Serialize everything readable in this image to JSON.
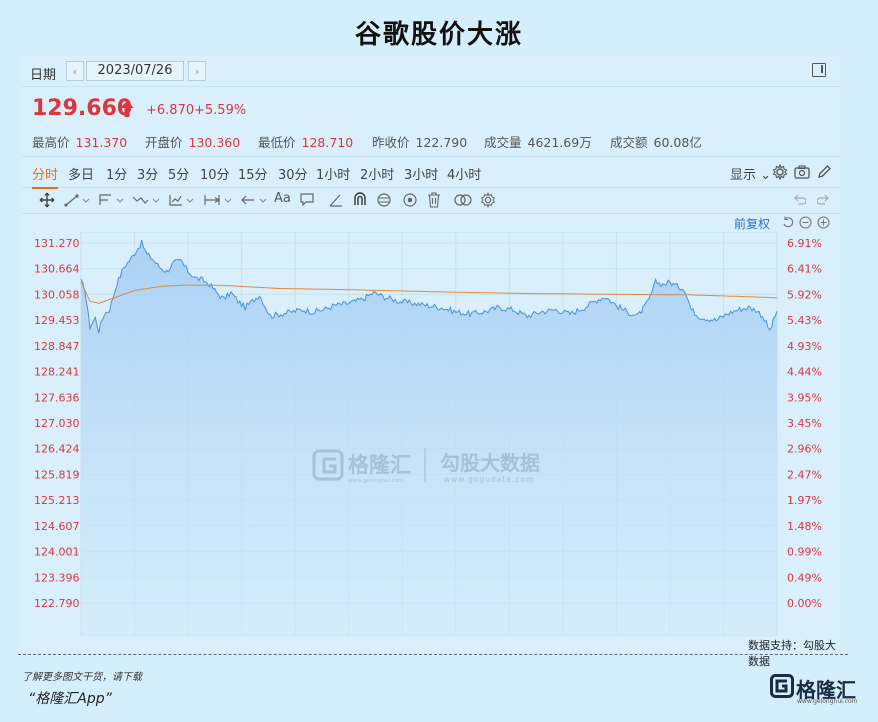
{
  "title": "谷歌股价大涨",
  "header": {
    "date_label": "日期",
    "prev": "‹",
    "date": "2023/07/26",
    "next": "›"
  },
  "quote": {
    "price": "129.660",
    "change": "+6.870",
    "change_pct": "+5.59%",
    "stats": [
      {
        "label": "最高价",
        "value": "131.370",
        "red": true
      },
      {
        "label": "开盘价",
        "value": "130.360",
        "red": true
      },
      {
        "label": "最低价",
        "value": "128.710",
        "red": true
      },
      {
        "label": "昨收价",
        "value": "122.790",
        "red": false
      },
      {
        "label": "成交量",
        "value": "4621.69万",
        "red": false
      },
      {
        "label": "成交额",
        "value": "60.08亿",
        "red": false
      }
    ]
  },
  "timeframes": [
    "分时",
    "多日",
    "1分",
    "3分",
    "5分",
    "10分",
    "15分",
    "30分",
    "1小时",
    "2小时",
    "3小时",
    "4小时"
  ],
  "active_timeframe": "分时",
  "display_label": "显示",
  "adjust_label": "前复权",
  "text_tool_label": "Aa",
  "source_label": "数据支持：勾股大数据",
  "watermark": {
    "brand": "格隆汇",
    "brand_url": "www.gelonghui.com",
    "data_brand": "勾股大数据",
    "data_url": "www.gogudata.com"
  },
  "footer": {
    "line1": "了解更多图文干货，请下载",
    "line2": "“格隆汇App”",
    "logo_text": "格隆汇",
    "logo_sub": "www.gelonghui.com"
  },
  "colors": {
    "up": "#d9363e",
    "line": "#4a90d9",
    "area": "#a9d0f5",
    "avg": "#e08a3c",
    "accent": "#e07020"
  },
  "chart_data": {
    "type": "area",
    "prev_close": 122.79,
    "ylim": [
      122.79,
      131.27
    ],
    "y_ticks": [
      "131.270",
      "130.664",
      "130.058",
      "129.453",
      "128.847",
      "128.241",
      "127.636",
      "127.030",
      "126.424",
      "125.819",
      "125.213",
      "124.607",
      "124.001",
      "123.396",
      "122.790"
    ],
    "y2_ticks": [
      "6.91%",
      "6.41%",
      "5.92%",
      "5.43%",
      "4.93%",
      "4.44%",
      "3.95%",
      "3.45%",
      "2.96%",
      "2.47%",
      "1.97%",
      "1.48%",
      "0.99%",
      "0.49%",
      "0.00%"
    ],
    "x_points": 391,
    "series": [
      {
        "role": "price",
        "keyframes": [
          [
            0,
            130.36
          ],
          [
            2,
            130.2
          ],
          [
            5,
            129.3
          ],
          [
            8,
            129.5
          ],
          [
            10,
            129.2
          ],
          [
            13,
            129.6
          ],
          [
            16,
            129.7
          ],
          [
            20,
            130.3
          ],
          [
            24,
            130.7
          ],
          [
            28,
            130.9
          ],
          [
            31,
            131.1
          ],
          [
            34,
            131.27
          ],
          [
            37,
            131.0
          ],
          [
            40,
            130.9
          ],
          [
            44,
            130.7
          ],
          [
            48,
            130.6
          ],
          [
            52,
            130.8
          ],
          [
            56,
            130.85
          ],
          [
            60,
            130.6
          ],
          [
            64,
            130.45
          ],
          [
            68,
            130.4
          ],
          [
            72,
            130.3
          ],
          [
            76,
            130.1
          ],
          [
            80,
            129.95
          ],
          [
            84,
            130.1
          ],
          [
            88,
            129.9
          ],
          [
            92,
            129.75
          ],
          [
            96,
            129.9
          ],
          [
            100,
            130.05
          ],
          [
            106,
            129.55
          ],
          [
            112,
            129.6
          ],
          [
            118,
            129.65
          ],
          [
            124,
            129.7
          ],
          [
            130,
            129.65
          ],
          [
            136,
            129.7
          ],
          [
            142,
            129.8
          ],
          [
            150,
            129.85
          ],
          [
            158,
            129.95
          ],
          [
            164,
            130.1
          ],
          [
            170,
            130.0
          ],
          [
            178,
            129.9
          ],
          [
            186,
            129.85
          ],
          [
            194,
            129.8
          ],
          [
            202,
            129.75
          ],
          [
            210,
            129.65
          ],
          [
            218,
            129.6
          ],
          [
            226,
            129.65
          ],
          [
            234,
            129.75
          ],
          [
            242,
            129.7
          ],
          [
            250,
            129.55
          ],
          [
            258,
            129.65
          ],
          [
            266,
            129.7
          ],
          [
            274,
            129.6
          ],
          [
            282,
            129.75
          ],
          [
            290,
            129.95
          ],
          [
            294,
            130.0
          ],
          [
            300,
            129.8
          ],
          [
            306,
            129.65
          ],
          [
            312,
            129.55
          ],
          [
            318,
            129.9
          ],
          [
            322,
            130.35
          ],
          [
            326,
            130.3
          ],
          [
            330,
            130.35
          ],
          [
            334,
            130.25
          ],
          [
            338,
            130.2
          ],
          [
            342,
            129.7
          ],
          [
            346,
            129.55
          ],
          [
            350,
            129.5
          ],
          [
            356,
            129.45
          ],
          [
            362,
            129.6
          ],
          [
            368,
            129.7
          ],
          [
            374,
            129.75
          ],
          [
            378,
            129.7
          ],
          [
            382,
            129.55
          ],
          [
            386,
            129.2
          ],
          [
            390,
            129.66
          ]
        ]
      },
      {
        "role": "average",
        "keyframes": [
          [
            0,
            130.36
          ],
          [
            5,
            129.9
          ],
          [
            10,
            129.85
          ],
          [
            20,
            130.0
          ],
          [
            30,
            130.15
          ],
          [
            45,
            130.25
          ],
          [
            60,
            130.28
          ],
          [
            80,
            130.27
          ],
          [
            110,
            130.2
          ],
          [
            150,
            130.17
          ],
          [
            200,
            130.12
          ],
          [
            250,
            130.08
          ],
          [
            300,
            130.06
          ],
          [
            340,
            130.05
          ],
          [
            370,
            130.01
          ],
          [
            390,
            129.98
          ]
        ]
      }
    ]
  }
}
